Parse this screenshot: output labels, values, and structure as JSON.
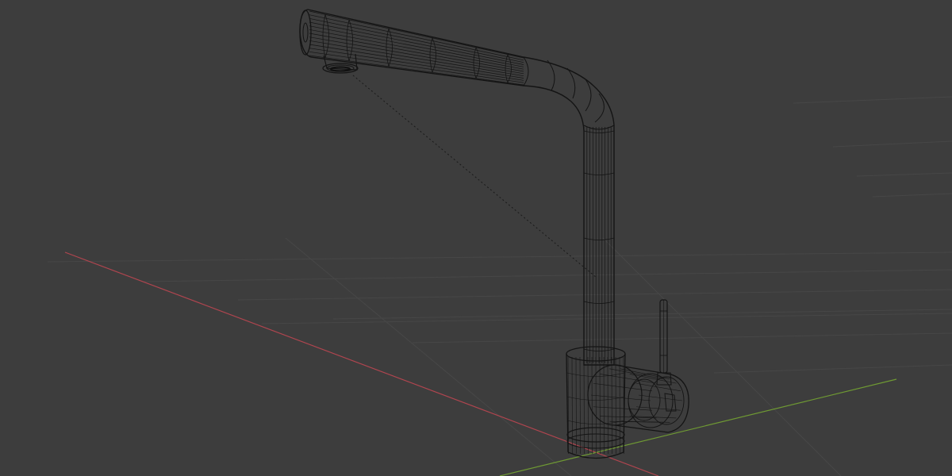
{
  "viewport": {
    "background": "#3d3d3d",
    "shading_mode": "wireframe",
    "object": "kitchen-faucet",
    "wire_color": "#141414",
    "grid_color": "#474747",
    "x_axis_color": "#b0454f",
    "y_axis_color": "#6f9a33",
    "light_line_color": "#1a1a1a"
  }
}
